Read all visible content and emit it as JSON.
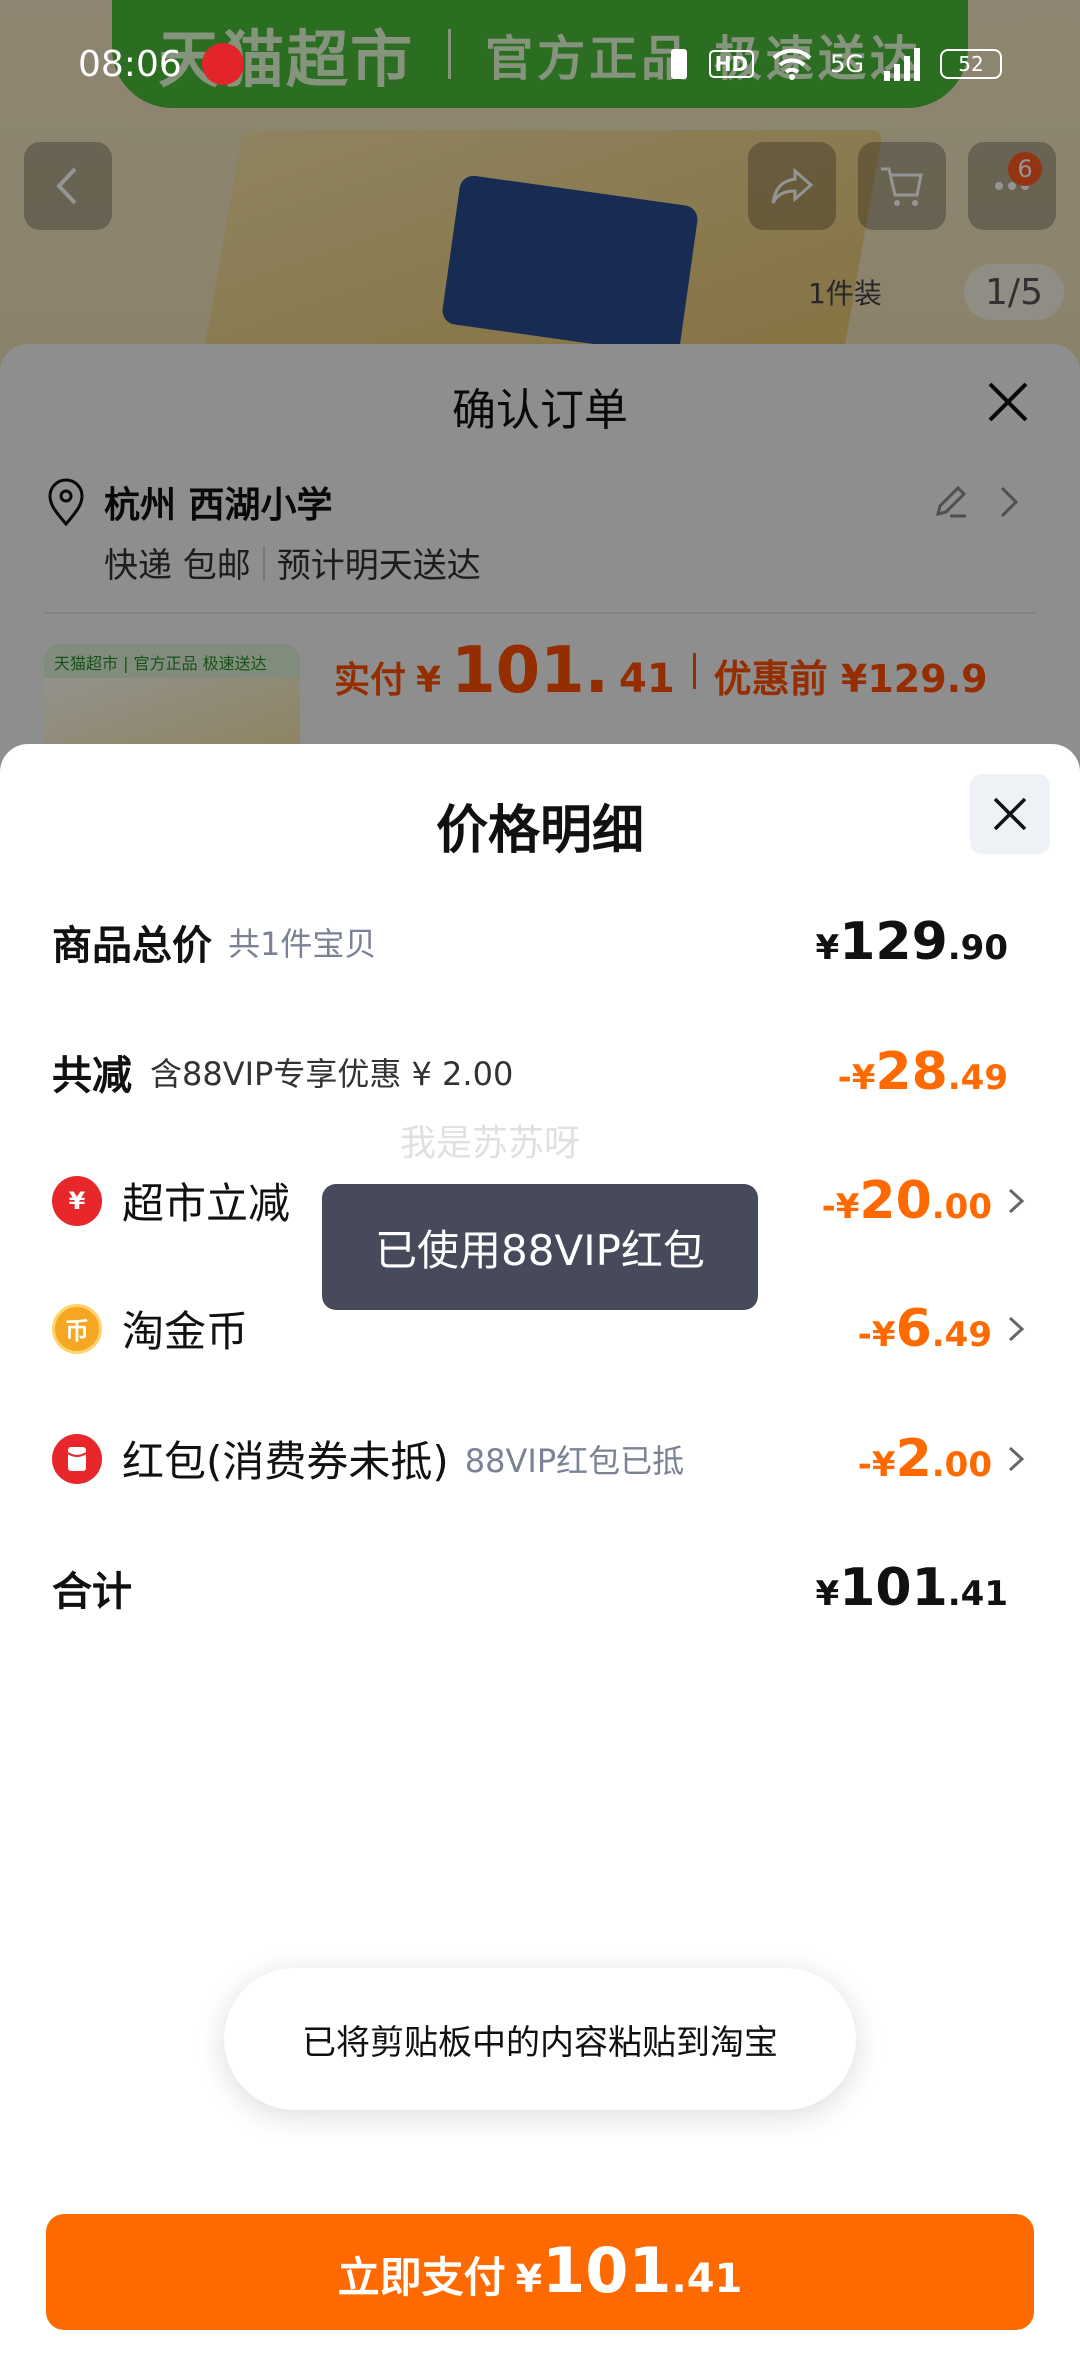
{
  "status": {
    "time": "08:06",
    "network": "5G",
    "hd": "HD",
    "battery": "52"
  },
  "banner": {
    "brand": "天猫超市",
    "slogan": "官方正品 极速送达"
  },
  "product_page": {
    "cart_count": "6",
    "pack_label": "1件装",
    "image_counter": "1/5"
  },
  "order": {
    "title": "确认订单",
    "address_name": "杭州 西湖小学",
    "delivery": "快递 包邮",
    "eta": "预计明天送达",
    "thumb_tag": "天猫超市 | 官方正品 极速送达",
    "paid_label": "实付",
    "paid_currency": "¥",
    "paid_int": "101.",
    "paid_dec": "41",
    "orig_label": "优惠前 ¥129.9"
  },
  "detail": {
    "title": "价格明细",
    "total_goods": {
      "label": "商品总价",
      "sub": "共1件宝贝",
      "currency": "¥",
      "int": "129",
      "dec": ".90"
    },
    "total_reduce": {
      "label": "共减",
      "sub": "含88VIP专享优惠 ¥ 2.00",
      "prefix": "-¥",
      "int": "28",
      "dec": ".49"
    },
    "items": [
      {
        "label": "超市立减",
        "sub": "",
        "prefix": "-¥",
        "int": "20",
        "dec": ".00",
        "icon": "coupon-red-icon"
      },
      {
        "label": "淘金币",
        "sub": "",
        "prefix": "-¥",
        "int": "6",
        "dec": ".49",
        "icon": "gold-coin-icon"
      },
      {
        "label": "红包(消费券未抵)",
        "sub": "88VIP红包已抵",
        "prefix": "-¥",
        "int": "2",
        "dec": ".00",
        "icon": "red-envelope-icon"
      }
    ],
    "sum": {
      "label": "合计",
      "currency": "¥",
      "int": "101",
      "dec": ".41"
    },
    "watermark": "我是苏苏呀",
    "vip_toast": "已使用88VIP红包",
    "clipboard_toast": "已将剪贴板中的内容粘贴到淘宝",
    "pay_button": {
      "label": "立即支付",
      "currency": "¥",
      "int": "101",
      "dec": ".41"
    }
  },
  "colors": {
    "accent": "#ff6a00",
    "banner_green": "#4dbd3a",
    "toast_dark": "#474a5b"
  }
}
